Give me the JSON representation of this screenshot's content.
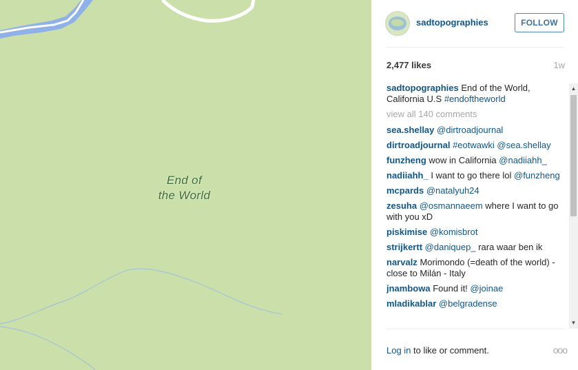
{
  "map": {
    "label_line1": "End of",
    "label_line2": "the World",
    "colors": {
      "land": "#cbdfaa",
      "water": "#8fb1e8",
      "road": "#ffffff",
      "stream": "#a3c3d8"
    }
  },
  "post": {
    "username": "sadtopographies",
    "follow_label": "FOLLOW",
    "likes": "2,477 likes",
    "age": "1w",
    "caption": {
      "user": "sadtopographies",
      "text": "End of the World, California U.S ",
      "tag": "#endoftheworld"
    },
    "view_all": "view all 140 comments",
    "comments": [
      {
        "user": "sea.shellay",
        "parts": [
          {
            "t": "link",
            "v": "@dirtroadjournal"
          }
        ]
      },
      {
        "user": "dirtroadjournal",
        "parts": [
          {
            "t": "link",
            "v": "#eotwawki"
          },
          {
            "t": "text",
            "v": " "
          },
          {
            "t": "link",
            "v": "@sea.shellay"
          }
        ]
      },
      {
        "user": "funzheng",
        "parts": [
          {
            "t": "text",
            "v": "wow in California "
          },
          {
            "t": "link",
            "v": "@nadiiahh_"
          }
        ]
      },
      {
        "user": "nadiiahh_",
        "parts": [
          {
            "t": "text",
            "v": "I want to go there lol "
          },
          {
            "t": "link",
            "v": "@funzheng"
          }
        ]
      },
      {
        "user": "mcpards",
        "parts": [
          {
            "t": "link",
            "v": "@natalyuh24"
          }
        ]
      },
      {
        "user": "zesuha",
        "parts": [
          {
            "t": "link",
            "v": "@osmannaeem"
          },
          {
            "t": "text",
            "v": " where I want to go with you xD"
          }
        ]
      },
      {
        "user": "piskimise",
        "parts": [
          {
            "t": "link",
            "v": "@komisbrot"
          }
        ]
      },
      {
        "user": "strijkertt",
        "parts": [
          {
            "t": "link",
            "v": "@daniquep_"
          },
          {
            "t": "text",
            "v": " rara waar ben ik"
          }
        ]
      },
      {
        "user": "narvalz",
        "parts": [
          {
            "t": "text",
            "v": "Morimondo (=death of the world) - close to Milán - Italy"
          }
        ]
      },
      {
        "user": "jnambowa",
        "parts": [
          {
            "t": "text",
            "v": "Found it! "
          },
          {
            "t": "link",
            "v": "@joinae"
          }
        ]
      },
      {
        "user": "mladikablar",
        "parts": [
          {
            "t": "link",
            "v": "@belgradense"
          }
        ]
      }
    ],
    "footer": {
      "login_link": "Log in",
      "login_rest": " to like or comment.",
      "more": "ooo"
    }
  },
  "icons": {
    "scroll_up": "▲",
    "scroll_down": "▼"
  }
}
